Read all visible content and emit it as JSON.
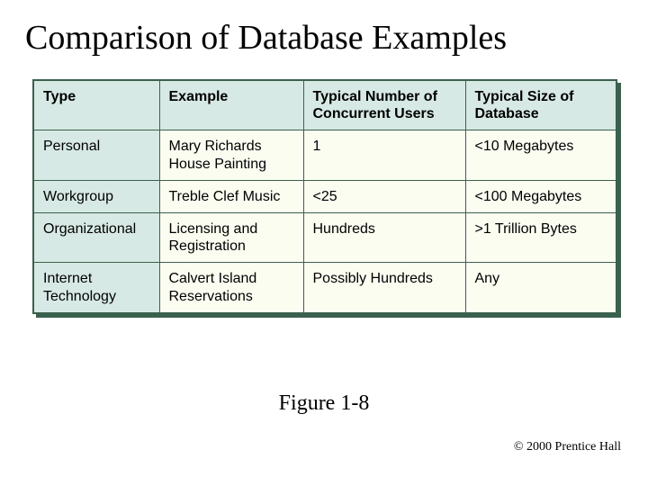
{
  "title": "Comparison of Database Examples",
  "table": {
    "headers": {
      "h0": "Type",
      "h1": "Example",
      "h2": "Typical Number of Concurrent Users",
      "h3": "Typical Size of Database"
    },
    "rows": [
      {
        "c0": "Personal",
        "c1": "Mary Richards House Painting",
        "c2": "1",
        "c3": "<10 Megabytes"
      },
      {
        "c0": "Workgroup",
        "c1": "Treble Clef Music",
        "c2": "<25",
        "c3": "<100 Megabytes"
      },
      {
        "c0": "Organizational",
        "c1": "Licensing and Registration",
        "c2": "Hundreds",
        "c3": ">1 Trillion Bytes"
      },
      {
        "c0": "Internet Technology",
        "c1": "Calvert Island Reservations",
        "c2": "Possibly Hundreds",
        "c3": "Any"
      }
    ]
  },
  "caption": "Figure 1-8",
  "copyright": "© 2000 Prentice Hall"
}
